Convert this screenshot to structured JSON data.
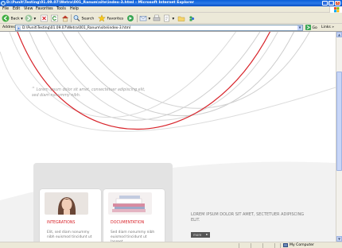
{
  "window": {
    "title": "D:\\Punit\\Testing\\01.09.07\\Wetra\\001_Ranum\\site\\index-3.html - Microsoft Internet Explorer"
  },
  "menu": [
    "File",
    "Edit",
    "View",
    "Favorites",
    "Tools",
    "Help"
  ],
  "toolbar": {
    "back_label": "Back",
    "search_label": "Search",
    "favorites_label": "Favorites"
  },
  "address": {
    "label": "Address",
    "url": "D:\\Punit\\Testing\\01.09.07\\Wetra\\001_Ranum\\site\\index-3.html",
    "go_label": "Go",
    "links_label": "Links"
  },
  "page": {
    "quote_mark": "“",
    "quote": "Lorem ipsum dolor sit amet, consectetuer adipiscing elit, sed diam nonummy nibh.",
    "cards": [
      {
        "title": "INTEGRATIONS",
        "text": "Elit, sed diam nonummy nibh euismod tincidunt ut"
      },
      {
        "title": "DOCUMENTATION",
        "text": "Sed diam nonummy nibh euismod tincidunt ut laoreet"
      }
    ],
    "lorem": "LOREM IPSUM DOLOR SIT AMET, SECTETUER ADIPISCING ELIT.",
    "more_label": "more"
  },
  "status": {
    "zone": "My Computer"
  },
  "colors": {
    "accent_red": "#d8232a",
    "xp_blue": "#0a5ed8",
    "chrome": "#ece9d8"
  }
}
